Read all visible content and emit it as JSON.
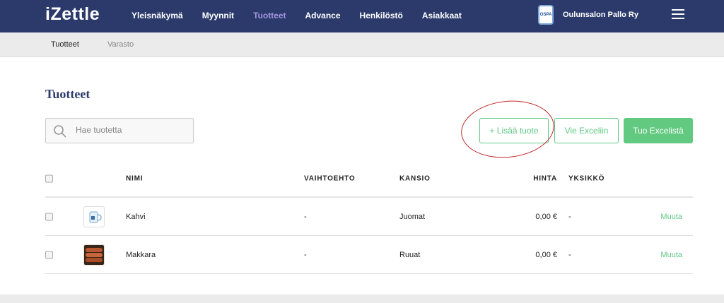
{
  "app": {
    "logo": "iZettle",
    "org_name": "Oulunsalon Pallo Ry",
    "org_badge": "OSPA"
  },
  "nav": [
    "Yleisnäkymä",
    "Myynnit",
    "Tuotteet",
    "Advance",
    "Henkilöstö",
    "Asiakkaat"
  ],
  "nav_active": 2,
  "subnav": [
    "Tuotteet",
    "Varasto"
  ],
  "page": {
    "title": "Tuotteet",
    "search_placeholder": "Hae tuotetta",
    "add_button": "+ Lisää tuote",
    "export_button": "Vie Exceliin",
    "import_button": "Tuo Excelistä"
  },
  "table": {
    "headers": {
      "name": "NIMI",
      "variant": "VAIHTOEHTO",
      "folder": "KANSIO",
      "price": "HINTA",
      "unit": "YKSIKKÖ"
    },
    "rows": [
      {
        "name": "Kahvi",
        "variant": "-",
        "folder": "Juomat",
        "price": "0,00 €",
        "unit": "-",
        "action": "Muuta",
        "icon": "coffee-cup-icon"
      },
      {
        "name": "Makkara",
        "variant": "-",
        "folder": "Ruuat",
        "price": "0,00 €",
        "unit": "-",
        "action": "Muuta",
        "icon": "sausage-icon"
      }
    ]
  },
  "colors": {
    "topbar": "#2b3a6b",
    "active_nav": "#a593e0",
    "accent_green": "#5fc784",
    "annotation_red": "#c0282b"
  }
}
